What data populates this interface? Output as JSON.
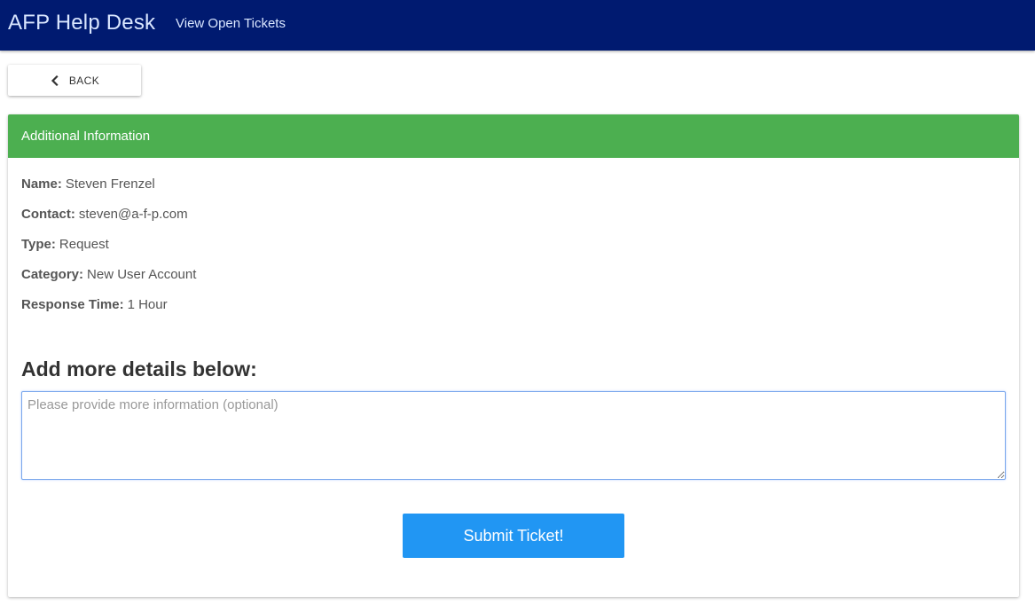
{
  "navbar": {
    "brand": "AFP Help Desk",
    "link": "View Open Tickets",
    "bg_color": "#001a70"
  },
  "back_button": {
    "label": "BACK",
    "icon": "chevron-left-icon"
  },
  "card": {
    "title": "Additional Information",
    "header_color": "#4caf50",
    "fields": [
      {
        "label": "Name:",
        "value": "Steven Frenzel"
      },
      {
        "label": "Contact:",
        "value": "steven@a-f-p.com"
      },
      {
        "label": "Type:",
        "value": "Request"
      },
      {
        "label": "Category:",
        "value": "New User Account"
      },
      {
        "label": "Response Time:",
        "value": "1 Hour"
      }
    ],
    "details_heading": "Add more details below:",
    "details_placeholder": "Please provide more information (optional)",
    "details_value": "",
    "submit_label": "Submit Ticket!",
    "submit_color": "#2196f3"
  }
}
